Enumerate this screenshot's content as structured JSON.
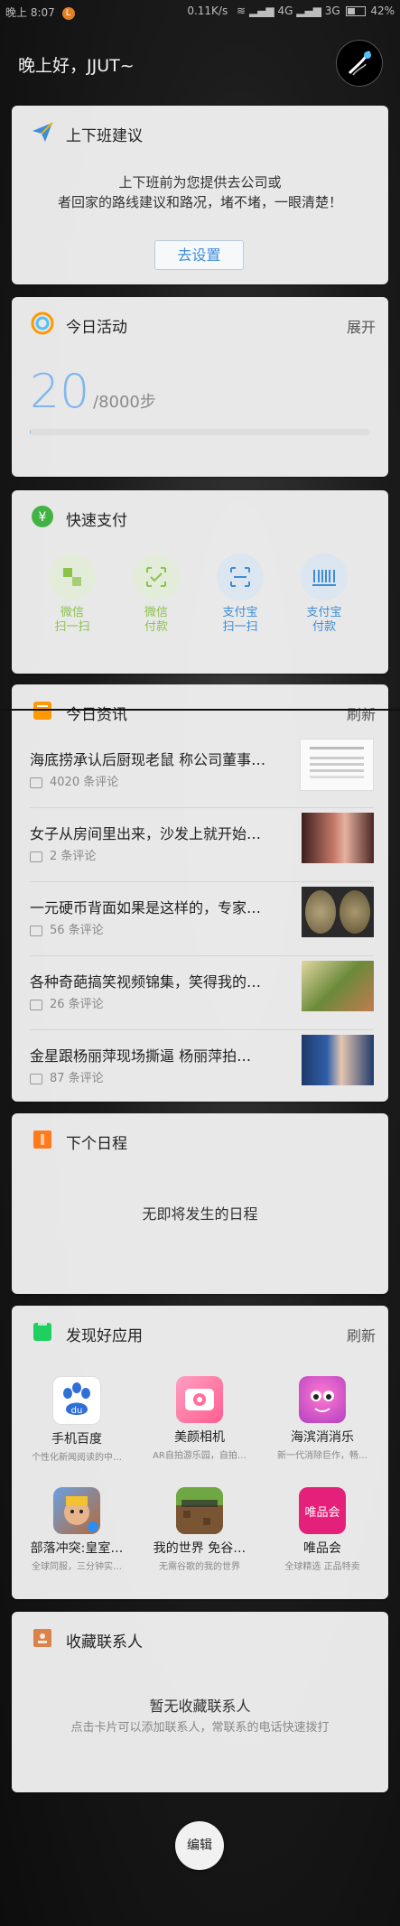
{
  "status_bar": {
    "time": "晚上 8:07",
    "notif_badge": "L",
    "network_speed": "0.11K/s",
    "signal": "4G",
    "signal2": "3G",
    "battery": "42%"
  },
  "greeting": "晚上好，JJUT~",
  "commute": {
    "title": "上下班建议",
    "line1": "上下班前为您提供去公司或",
    "line2": "者回家的路线建议和路况，堵不堵，一眼清楚！",
    "button": "去设置"
  },
  "activity": {
    "title": "今日活动",
    "action": "展开",
    "steps": "20",
    "goal": "/8000步",
    "progress": 0.0025
  },
  "quick_pay": {
    "title": "快速支付",
    "items": [
      {
        "line1": "微信",
        "line2": "扫一扫",
        "icon": "wechat-scan-icon",
        "color": "#8bc34a"
      },
      {
        "line1": "微信",
        "line2": "付款",
        "icon": "wechat-pay-icon",
        "color": "#8bc34a"
      },
      {
        "line1": "支付宝",
        "line2": "扫一扫",
        "icon": "alipay-scan-icon",
        "color": "#3d8dd8"
      },
      {
        "line1": "支付宝",
        "line2": "付款",
        "icon": "alipay-pay-icon",
        "color": "#3d8dd8"
      }
    ]
  },
  "news": {
    "title": "今日资讯",
    "action": "刷新",
    "items": [
      {
        "title": "海底捞承认后厨现老鼠 称公司董事会…",
        "comments": "4020 条评论"
      },
      {
        "title": "女子从房间里出来，沙发上就开始…",
        "comments": "2 条评论"
      },
      {
        "title": "一元硬币背面如果是这样的，专家…",
        "comments": "56 条评论"
      },
      {
        "title": "各种奇葩搞笑视频锦集，笑得我的…",
        "comments": "26 条评论"
      },
      {
        "title": "金星跟杨丽萍现场撕逼 杨丽萍拍…",
        "comments": "87 条评论"
      }
    ]
  },
  "schedule": {
    "title": "下个日程",
    "empty": "无即将发生的日程"
  },
  "apps": {
    "title": "发现好应用",
    "action": "刷新",
    "items": [
      {
        "name": "手机百度",
        "desc": "个性化新闻阅读的中…"
      },
      {
        "name": "美颜相机",
        "desc": "AR自拍游乐园，自拍…"
      },
      {
        "name": "海滨消消乐",
        "desc": "新一代消除巨作，畅…"
      },
      {
        "name": "部落冲突:皇室…",
        "desc": "全球同服，三分钟实…"
      },
      {
        "name": "我的世界 免谷…",
        "desc": "无需谷歌的我的世界"
      },
      {
        "name": "唯品会",
        "desc": "全球精选  正品特卖",
        "logo_text": "唯品会"
      }
    ]
  },
  "contacts": {
    "title": "收藏联系人",
    "empty": "暂无收藏联系人",
    "hint": "点击卡片可以添加联系人，常联系的电话快速拨打"
  },
  "edit_button": "编辑"
}
